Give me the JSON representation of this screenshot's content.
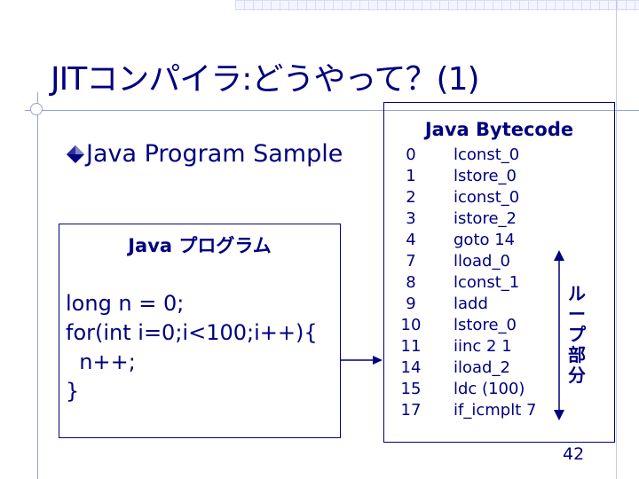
{
  "slide": {
    "title": "JITコンパイラ:どうやって？(1)",
    "bullet": "Java Program Sample",
    "page_number": "42"
  },
  "program": {
    "title": "Java プログラム",
    "lines": [
      "long n = 0;",
      "for(int i=0;i<100;i++){",
      "  n++;",
      "}"
    ]
  },
  "bytecode": {
    "title": "Java Bytecode",
    "rows": [
      {
        "offset": "0",
        "instr": "lconst_0"
      },
      {
        "offset": "1",
        "instr": "lstore_0"
      },
      {
        "offset": "2",
        "instr": "iconst_0"
      },
      {
        "offset": "3",
        "instr": "istore_2"
      },
      {
        "offset": "4",
        "instr": "goto 14"
      },
      {
        "offset": "7",
        "instr": "lload_0"
      },
      {
        "offset": "8",
        "instr": "lconst_1"
      },
      {
        "offset": "9",
        "instr": "ladd"
      },
      {
        "offset": "10",
        "instr": "lstore_0"
      },
      {
        "offset": "11",
        "instr": "iinc 2 1"
      },
      {
        "offset": "14",
        "instr": "iload_2"
      },
      {
        "offset": "15",
        "instr": "ldc (100)"
      },
      {
        "offset": "17",
        "instr": "if_icmplt 7"
      }
    ],
    "loop_label": [
      "ル",
      "ー",
      "プ",
      "部",
      "分"
    ]
  },
  "colors": {
    "text": "#000080",
    "bullet_diamond": "#000080",
    "grid": "#d6dcf6"
  }
}
